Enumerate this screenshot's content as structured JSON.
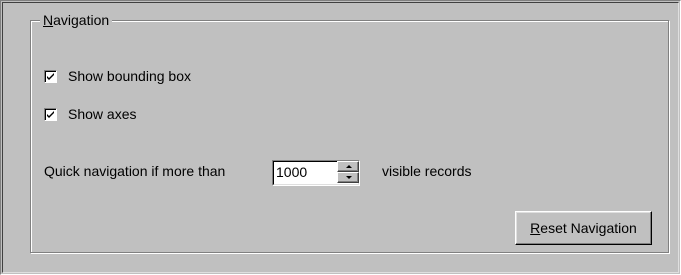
{
  "group": {
    "title_mnemonic": "N",
    "title_rest": "avigation"
  },
  "options": {
    "show_bounding_box": {
      "label": "Show bounding box",
      "checked": true
    },
    "show_axes": {
      "label": "Show axes",
      "checked": true
    }
  },
  "quick_navigation": {
    "label": "Quick navigation if more than",
    "value": "1000",
    "suffix": "visible records"
  },
  "reset_button": {
    "mnemonic": "R",
    "rest": "eset Navigation"
  },
  "icons": {
    "check": "checkmark-icon",
    "spin_up": "arrow-up-icon",
    "spin_down": "arrow-down-icon"
  }
}
